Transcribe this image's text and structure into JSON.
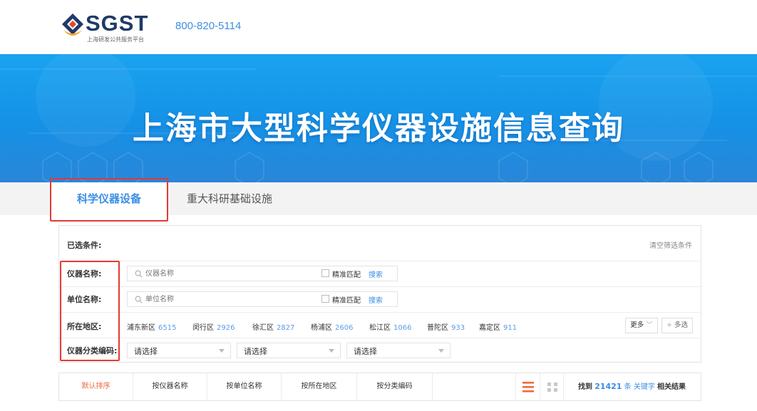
{
  "header": {
    "logo_text": "SGST",
    "logo_subtitle": "上海研发公共服务平台",
    "phone": "800-820-5114"
  },
  "banner": {
    "title": "上海市大型科学仪器设施信息查询"
  },
  "tabs": [
    {
      "label": "科学仪器设备",
      "active": true
    },
    {
      "label": "重大科研基础设施",
      "active": false
    }
  ],
  "filters": {
    "selected_label": "已选条件:",
    "clear_label": "清空筛选条件",
    "instrument": {
      "label": "仪器名称:",
      "placeholder": "仪器名称",
      "exact_label": "精准匹配",
      "search_label": "搜索"
    },
    "org": {
      "label": "单位名称:",
      "placeholder": "单位名称",
      "exact_label": "精准匹配",
      "search_label": "搜索"
    },
    "region": {
      "label": "所在地区:",
      "items": [
        {
          "name": "浦东新区",
          "count": "6515"
        },
        {
          "name": "闵行区",
          "count": "2926"
        },
        {
          "name": "徐汇区",
          "count": "2827"
        },
        {
          "name": "杨浦区",
          "count": "2606"
        },
        {
          "name": "松江区",
          "count": "1066"
        },
        {
          "name": "普陀区",
          "count": "933"
        },
        {
          "name": "嘉定区",
          "count": "911"
        }
      ],
      "more_label": "更多",
      "multi_label": "多选"
    },
    "category": {
      "label": "仪器分类编码:",
      "selects": [
        "请选择",
        "请选择",
        "请选择"
      ]
    }
  },
  "sortbar": {
    "items": [
      "默认排序",
      "按仪器名称",
      "按单位名称",
      "按所在地区",
      "按分类编码"
    ],
    "result_prefix": "找到",
    "result_count": "21421",
    "result_unit": "条",
    "result_keyword": "关键字",
    "result_suffix": "相关结果"
  },
  "colors": {
    "accent": "#3a8ee6",
    "sort_active": "#f06a3b",
    "highlight_box": "#e53935"
  }
}
